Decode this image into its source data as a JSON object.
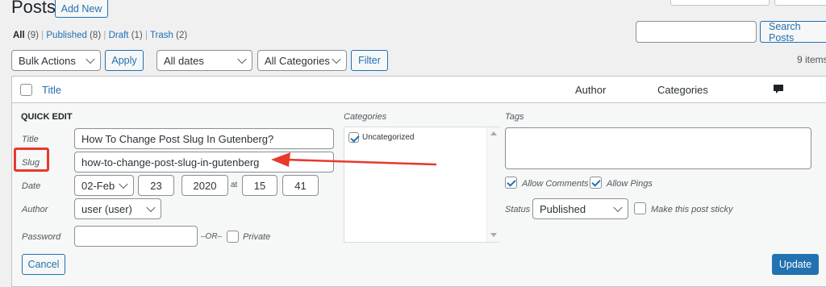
{
  "header": {
    "title": "Posts",
    "add_new_label": "Add New"
  },
  "filters": {
    "all_label": "All",
    "all_count": "(9)",
    "published_label": "Published",
    "published_count": "(8)",
    "draft_label": "Draft",
    "draft_count": "(1)",
    "trash_label": "Trash",
    "trash_count": "(2)",
    "separator": "|"
  },
  "search": {
    "value": "",
    "button_label": "Search Posts"
  },
  "toolbar": {
    "bulk_actions": "Bulk Actions",
    "apply_label": "Apply",
    "dates": "All dates",
    "categories": "All Categories",
    "filter_label": "Filter",
    "items_count": "9 items"
  },
  "table": {
    "col_title": "Title",
    "col_author": "Author",
    "col_categories": "Categories"
  },
  "quick_edit": {
    "heading": "QUICK EDIT",
    "title_label": "Title",
    "title_value": "How To Change Post Slug In Gutenberg?",
    "slug_label": "Slug",
    "slug_value": "how-to-change-post-slug-in-gutenberg",
    "date_label": "Date",
    "month": "02-Feb",
    "day": "23",
    "year": "2020",
    "at": "at",
    "hour": "15",
    "minute": "41",
    "author_label": "Author",
    "author_value": "user (user)",
    "password_label": "Password",
    "password_value": "",
    "or_text": "–OR–",
    "private_label": "Private",
    "categories_heading": "Categories",
    "category_item": "Uncategorized",
    "tags_heading": "Tags",
    "allow_comments": "Allow Comments",
    "allow_pings": "Allow Pings",
    "status_label": "Status",
    "status_value": "Published",
    "sticky_label": "Make this post sticky",
    "cancel_label": "Cancel",
    "update_label": "Update"
  },
  "colors": {
    "annotation": "#e8392b",
    "primary": "#2271b1"
  }
}
